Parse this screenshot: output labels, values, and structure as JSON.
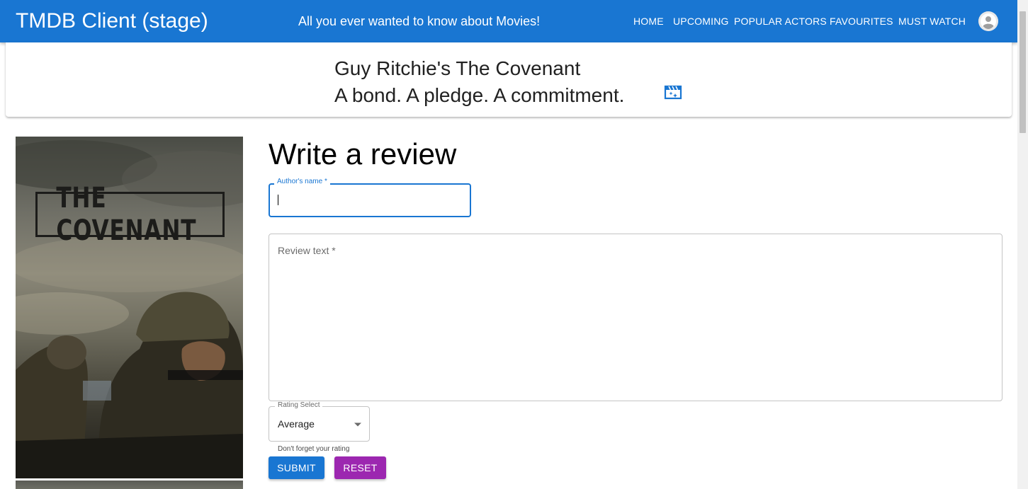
{
  "appbar": {
    "title": "TMDB Client (stage)",
    "tagline": "All you ever wanted to know about Movies!",
    "nav": [
      {
        "label": "Home"
      },
      {
        "label": "Upcoming"
      },
      {
        "label": "Popular Actors"
      },
      {
        "label": "Favourites"
      },
      {
        "label": "Must Watch"
      }
    ],
    "avatar_icon": "account-circle-icon",
    "background_color": "#1976d2"
  },
  "movie": {
    "title": "Guy Ritchie's The Covenant",
    "tagline": "A bond. A pledge. A commitment.",
    "tagline_icon": "movie-filter-icon",
    "poster_text": "THE COVENANT"
  },
  "review_form": {
    "heading": "Write a review",
    "author": {
      "label": "Author's name *",
      "value": ""
    },
    "review_text": {
      "placeholder": "Review text *",
      "value": ""
    },
    "rating": {
      "label": "Rating Select",
      "value": "Average",
      "helper": "Don't forget your rating"
    },
    "submit_label": "Submit",
    "reset_label": "Reset",
    "submit_color": "#1976d2",
    "reset_color": "#9c27b0"
  }
}
